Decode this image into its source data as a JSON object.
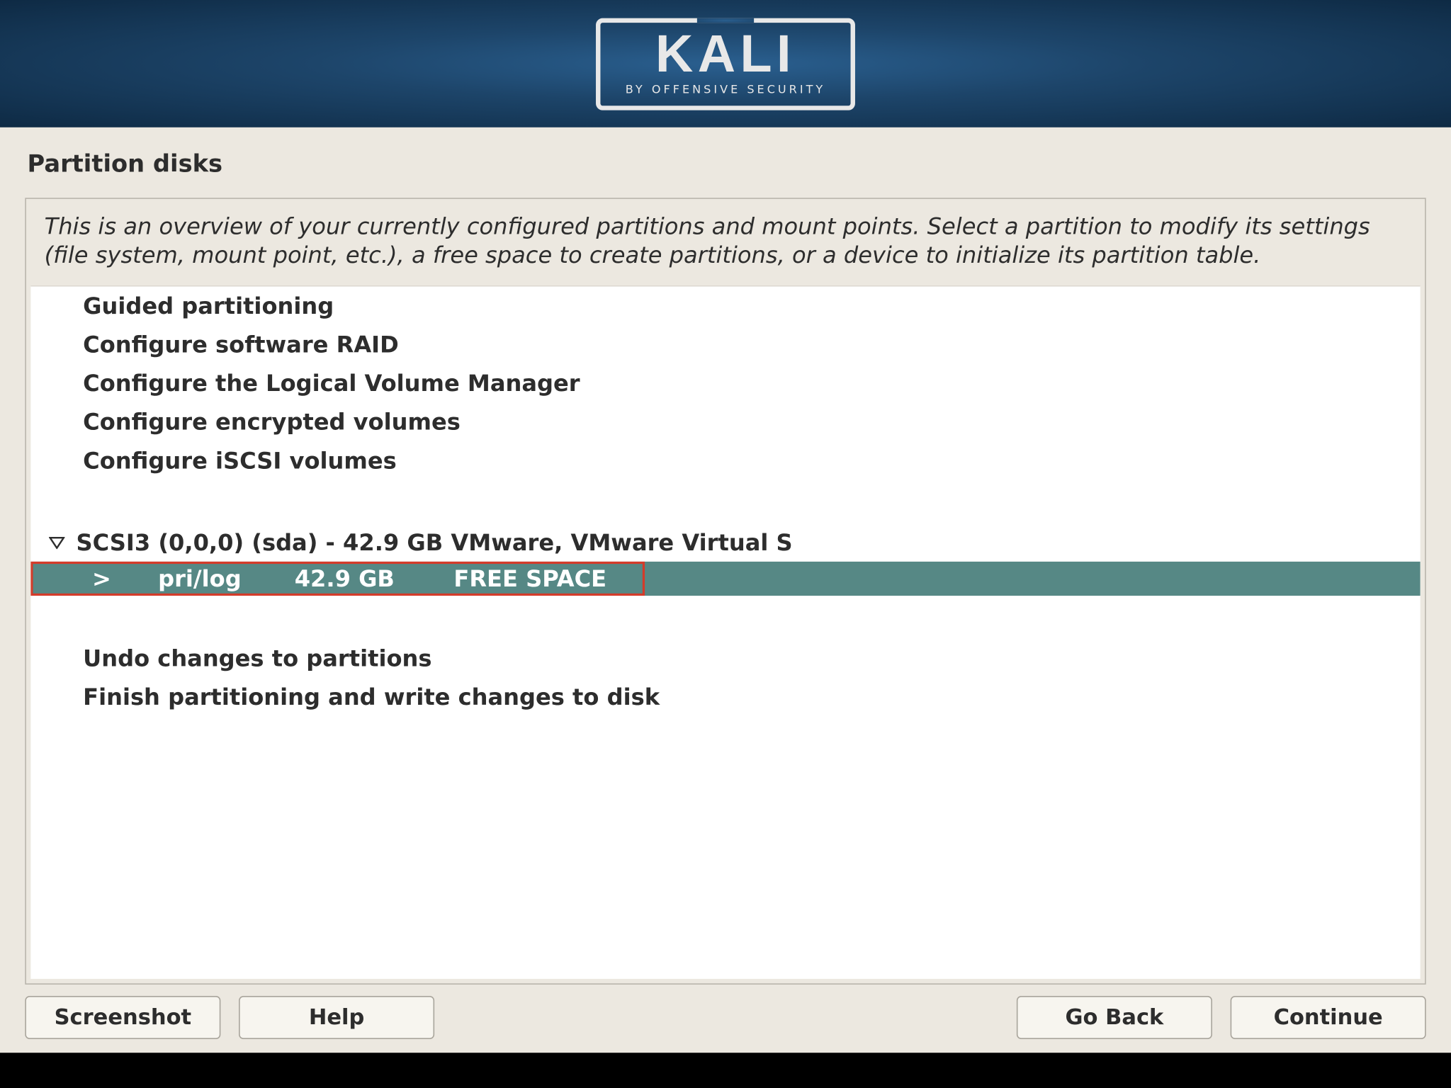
{
  "header": {
    "logo_text": "KALI",
    "logo_subtitle": "BY OFFENSIVE SECURITY"
  },
  "step": {
    "title": "Partition disks",
    "intro": "This is an overview of your currently configured partitions and mount points. Select a partition to modify its settings (file system, mount point, etc.), a free space to create partitions, or a device to initialize its partition table."
  },
  "options": {
    "guided": "Guided partitioning",
    "raid": "Configure software RAID",
    "lvm": "Configure the Logical Volume Manager",
    "encrypted": "Configure encrypted volumes",
    "iscsi": "Configure iSCSI volumes"
  },
  "disk": {
    "label": "SCSI3 (0,0,0) (sda) - 42.9 GB VMware, VMware Virtual S",
    "partition": {
      "arrow": ">",
      "type": "pri/log",
      "size": "42.9 GB",
      "label": "FREE SPACE"
    }
  },
  "actions": {
    "undo": "Undo changes to partitions",
    "finish": "Finish partitioning and write changes to disk"
  },
  "buttons": {
    "screenshot": "Screenshot",
    "help": "Help",
    "goback": "Go Back",
    "continue": "Continue"
  }
}
